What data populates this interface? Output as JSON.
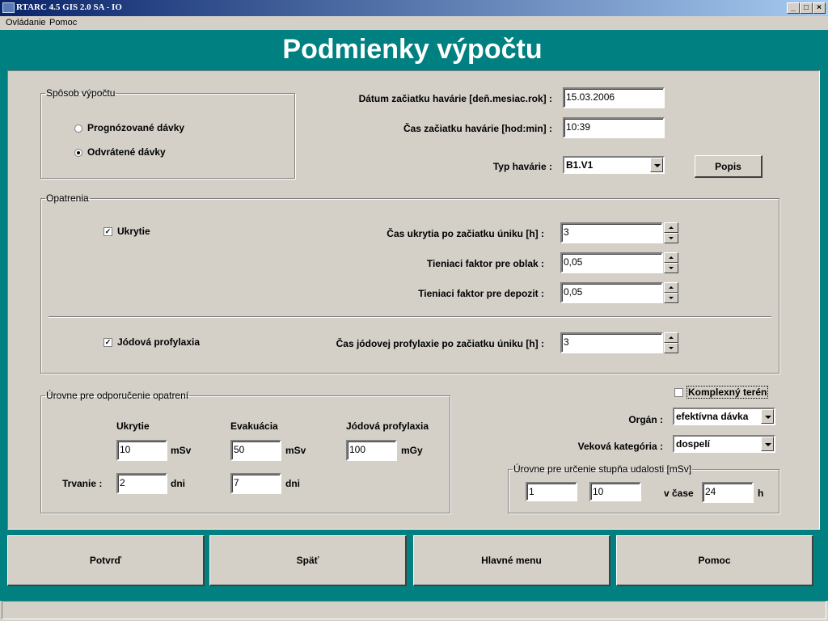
{
  "window": {
    "title": "RTARC 4.5 GIS 2.0 SA - IO",
    "controls": [
      "_",
      "□",
      "×"
    ]
  },
  "menu": [
    {
      "label": "Ovládanie"
    },
    {
      "label": "Pomoc"
    }
  ],
  "page_title": "Podmienky výpočtu",
  "calc_method": {
    "legend": "Spôsob výpočtu",
    "options": [
      {
        "label": "Prognózované dávky",
        "selected": false
      },
      {
        "label": "Odvrátené dávky",
        "selected": true
      }
    ]
  },
  "accident": {
    "date_label": "Dátum začiatku havárie [deň.mesiac.rok] :",
    "date_value": "15.03.2006",
    "time_label": "Čas začiatku havárie [hod:min] :",
    "time_value": "10:39",
    "type_label": "Typ havárie :",
    "type_value": "B1.V1",
    "popis_button": "Popis"
  },
  "measures": {
    "legend": "Opatrenia",
    "sheltering": {
      "label": "Ukrytie",
      "checked": true
    },
    "shelter_time_label": "Čas ukrytia po začiatku úniku [h] :",
    "shelter_time_value": "3",
    "cloud_factor_label": "Tieniaci faktor pre oblak :",
    "cloud_factor_value": "0,05",
    "deposit_factor_label": "Tieniaci faktor pre depozit :",
    "deposit_factor_value": "0,05",
    "iodine": {
      "label": "Jódová profylaxia",
      "checked": true
    },
    "iodine_time_label": "Čas jódovej profylaxie po začiatku úniku [h] :",
    "iodine_time_value": "3"
  },
  "levels": {
    "legend": "Úrovne pre odporučenie opatrení",
    "col_shelter": "Ukrytie",
    "col_evacuation": "Evakuácia",
    "col_iodine": "Jódová profylaxia",
    "shelter_value": "10",
    "shelter_unit": "mSv",
    "evacuation_value": "50",
    "evacuation_unit": "mSv",
    "iodine_value": "100",
    "iodine_unit": "mGy",
    "duration_label": "Trvanie :",
    "shelter_duration": "2",
    "evacuation_duration": "7",
    "days_unit": "dni"
  },
  "complex_terrain": {
    "label": "Komplexný terén",
    "checked": false
  },
  "organ": {
    "label": "Orgán :",
    "value": "efektívna dávka"
  },
  "age_category": {
    "label": "Veková kategória :",
    "value": "dospelí"
  },
  "event_levels": {
    "legend": "Úrovne pre určenie stupňa udalosti [mSv]",
    "value1": "1",
    "value2": "10",
    "time_label": "v čase",
    "time_value": "24",
    "unit": "h"
  },
  "buttons": {
    "confirm": "Potvrď",
    "back": "Späť",
    "main_menu": "Hlavné menu",
    "help": "Pomoc"
  }
}
